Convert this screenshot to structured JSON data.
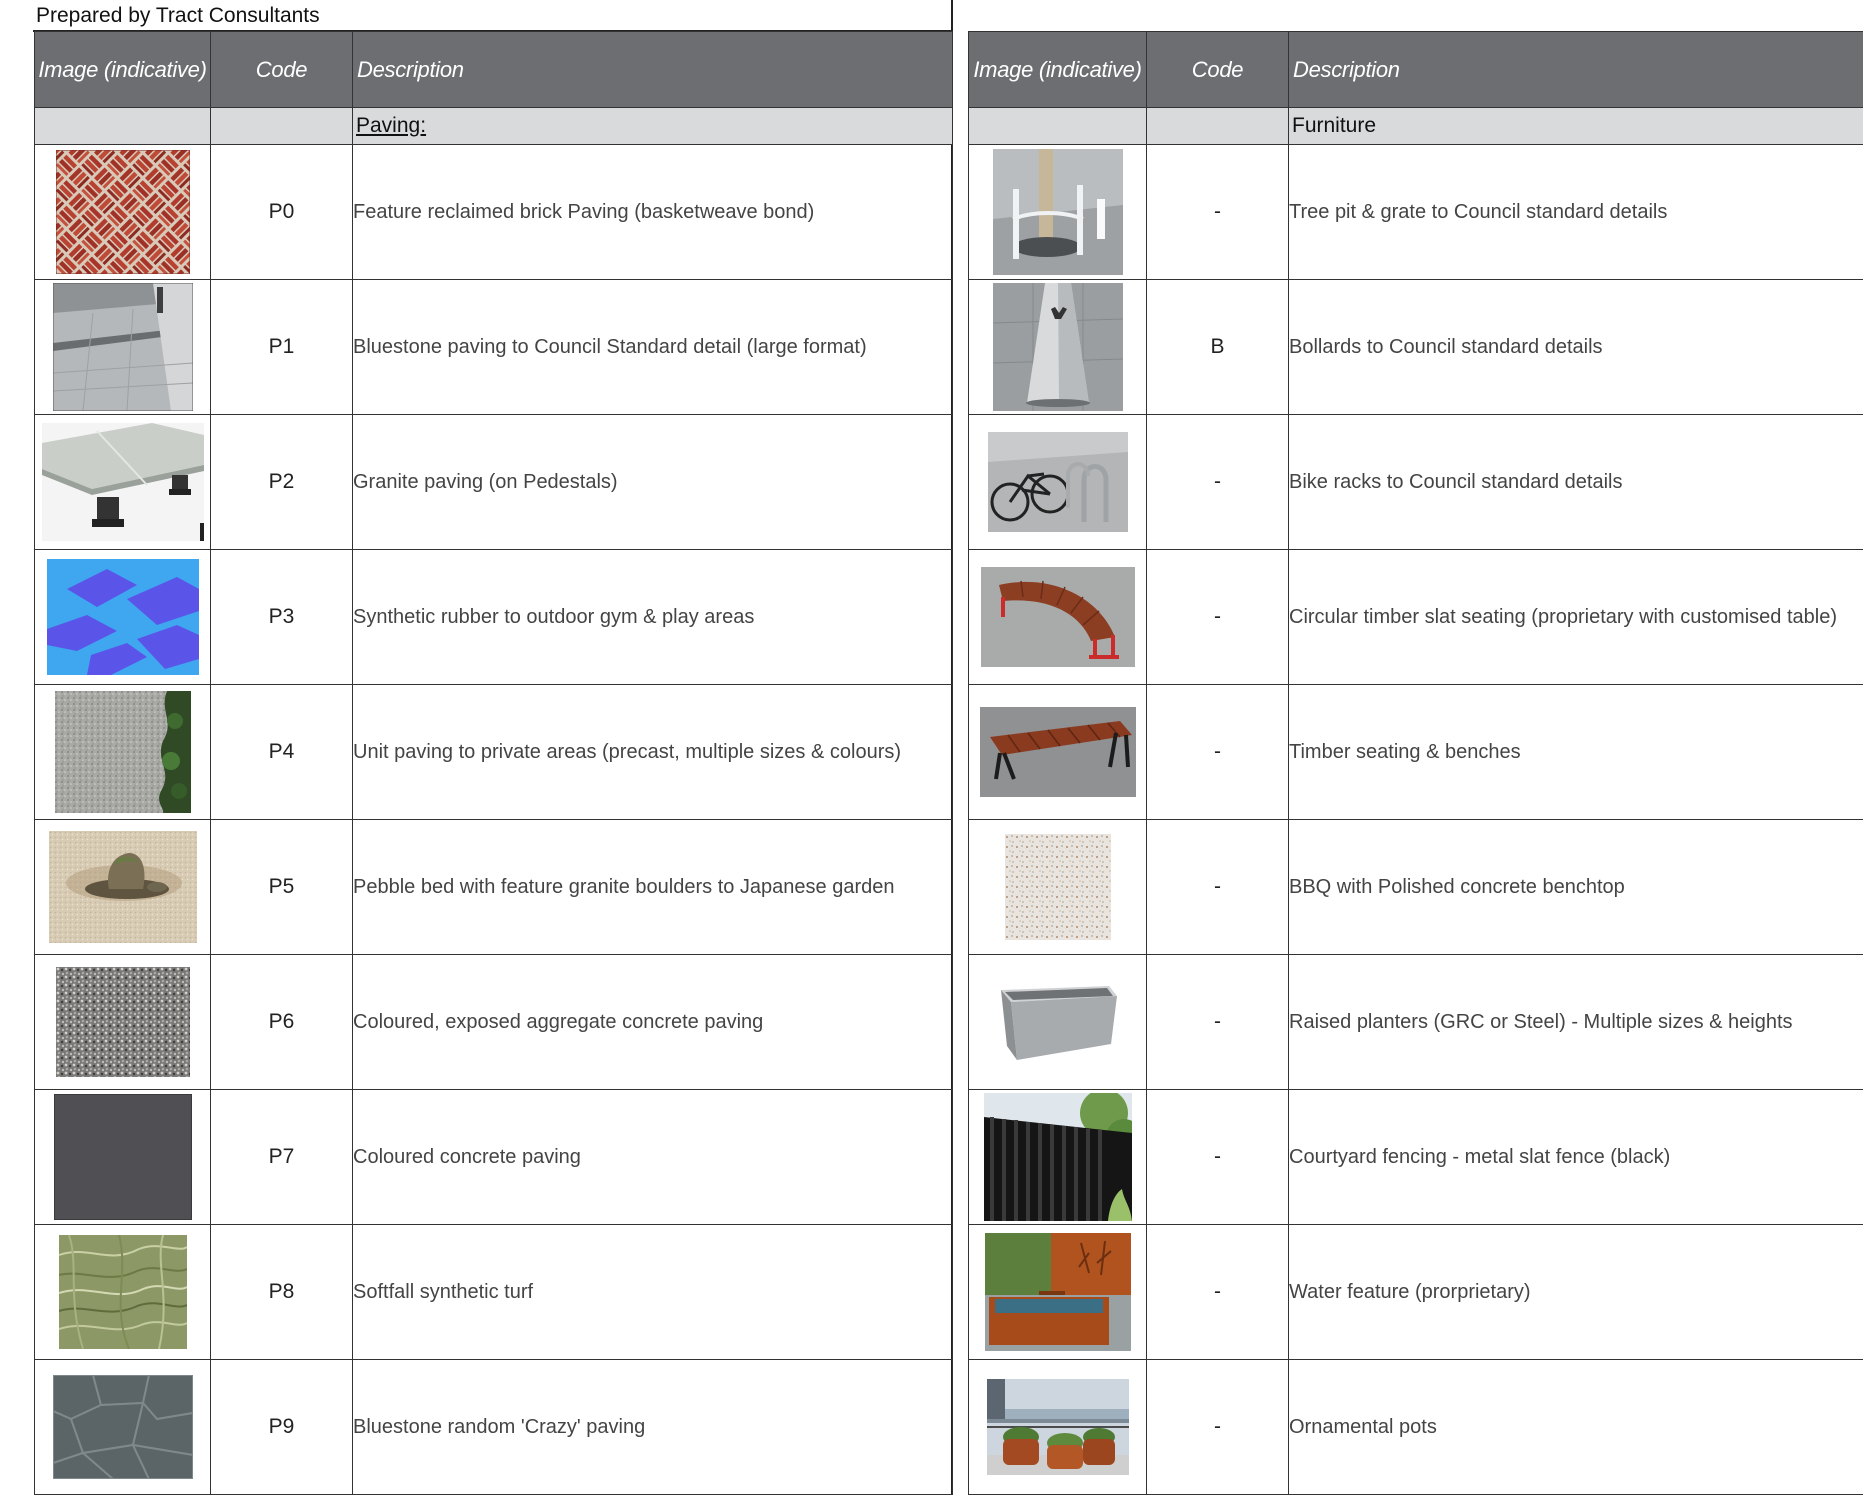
{
  "prepared_by": "Prepared by Tract Consultants",
  "headers": {
    "image": "Image (indicative)",
    "code": "Code",
    "description": "Description"
  },
  "paving": {
    "section_label": "Paving:",
    "rows": [
      {
        "code": "P0",
        "description": "Feature reclaimed brick Paving (basketweave bond)",
        "image": "brick-basketweave"
      },
      {
        "code": "P1",
        "description": "Bluestone paving to Council Standard detail (large format)",
        "image": "bluestone-footpath"
      },
      {
        "code": "P2",
        "description": "Granite paving (on Pedestals)",
        "image": "pedestal-paving"
      },
      {
        "code": "P3",
        "description": "Synthetic rubber to outdoor gym & play areas",
        "image": "blue-rubber"
      },
      {
        "code": "P4",
        "description": "Unit paving to private areas (precast, multiple sizes & colours)",
        "image": "precast-unit-paving"
      },
      {
        "code": "P5",
        "description": "Pebble bed with feature granite boulders to Japanese garden",
        "image": "japanese-garden"
      },
      {
        "code": "P6",
        "description": "Coloured, exposed aggregate concrete paving",
        "image": "exposed-aggregate"
      },
      {
        "code": "P7",
        "description": "Coloured concrete paving",
        "image": "charcoal-concrete"
      },
      {
        "code": "P8",
        "description": "Softfall synthetic turf",
        "image": "synthetic-turf"
      },
      {
        "code": "P9",
        "description": "Bluestone random 'Crazy' paving",
        "image": "crazy-paving"
      }
    ]
  },
  "furniture": {
    "section_label": "Furniture",
    "rows": [
      {
        "code": "-",
        "description": "Tree pit & grate to Council standard details",
        "image": "tree-pit"
      },
      {
        "code": "B",
        "description": "Bollards to Council standard details",
        "image": "bollard"
      },
      {
        "code": "-",
        "description": "Bike racks to Council standard details",
        "image": "bike-rack"
      },
      {
        "code": "-",
        "description": "Circular timber slat seating (proprietary with customised table)",
        "image": "curved-bench"
      },
      {
        "code": "-",
        "description": "Timber seating & benches",
        "image": "timber-bench"
      },
      {
        "code": "-",
        "description": "BBQ with Polished concrete benchtop",
        "image": "polished-concrete"
      },
      {
        "code": "-",
        "description": "Raised planters (GRC or Steel) - Multiple sizes & heights",
        "image": "raised-planter"
      },
      {
        "code": "-",
        "description": "Courtyard fencing - metal slat fence (black)",
        "image": "slat-fence"
      },
      {
        "code": "-",
        "description": "Water feature (prorprietary)",
        "image": "water-feature"
      },
      {
        "code": "-",
        "description": "Ornamental pots",
        "image": "ornamental-pots"
      }
    ]
  }
}
